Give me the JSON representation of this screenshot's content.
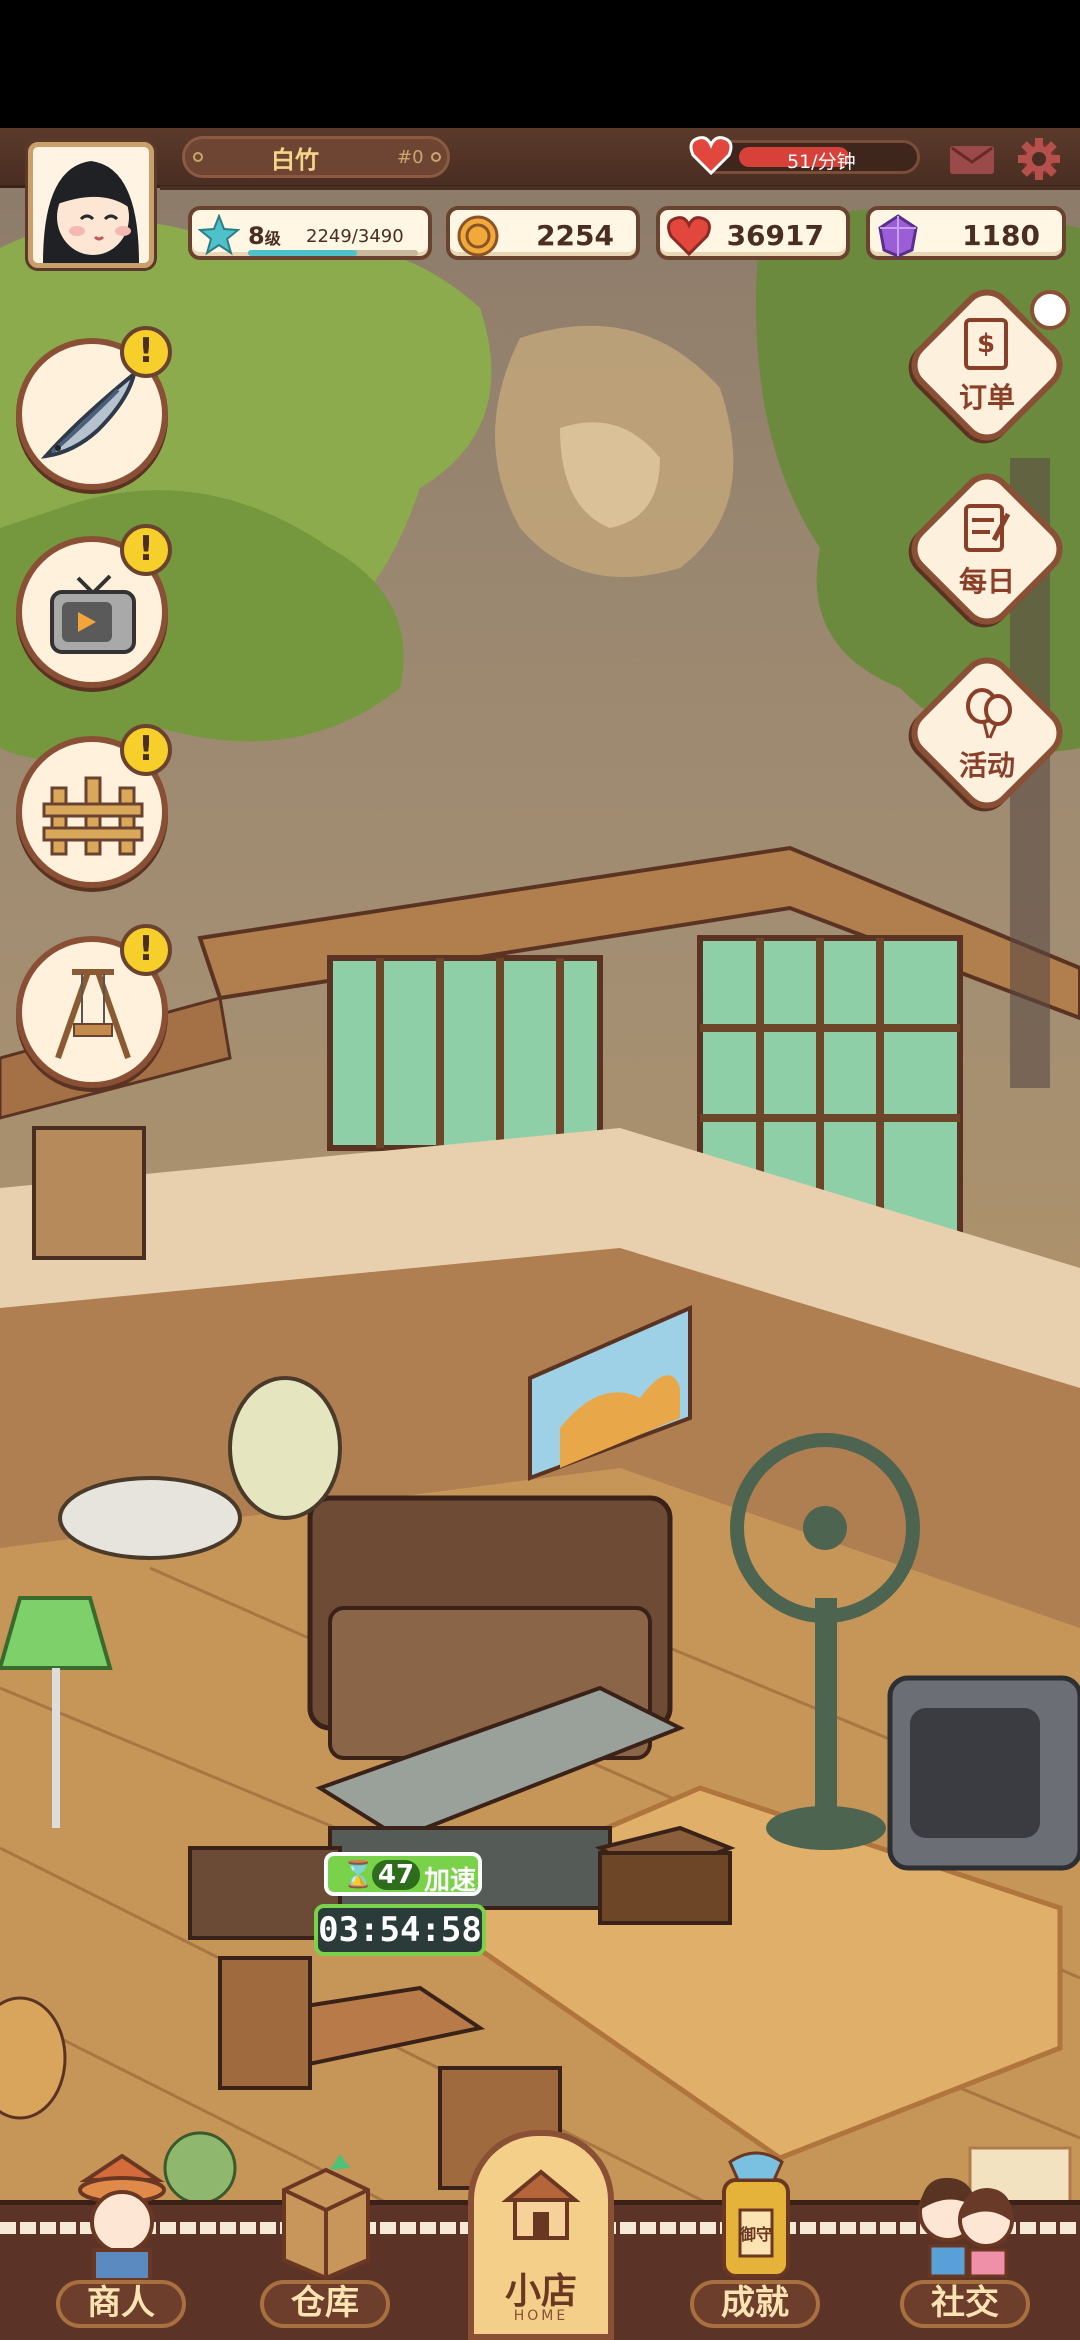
{
  "player": {
    "name": "白竹",
    "id": "#0",
    "energy_rate": "51/分钟",
    "level": "8",
    "level_unit": "级",
    "xp": "2249/3490",
    "xp_fraction": 0.644
  },
  "currencies": {
    "coins": "2254",
    "hearts": "36917",
    "gems": "1180"
  },
  "quests": [
    {
      "icon": "fish-icon",
      "alert": "!"
    },
    {
      "icon": "tv-video-icon",
      "alert": "!"
    },
    {
      "icon": "wooden-fence-icon",
      "alert": "!"
    },
    {
      "icon": "wooden-swing-icon",
      "alert": "!"
    }
  ],
  "right_buttons": {
    "orders": "订单",
    "daily": "每日",
    "events": "活动"
  },
  "timer": {
    "count": "47",
    "speedup": "加速",
    "time": "03:54:58"
  },
  "nav": {
    "merchant": "商人",
    "warehouse": "仓库",
    "shop": "小店",
    "shop_sub": "HOME",
    "achievements": "成就",
    "social": "社交",
    "charm_text": "御守"
  },
  "colors": {
    "hud_brown": "#5b3a2b",
    "alert_yellow": "#f7cf2a",
    "speed_green": "#7ad24a"
  }
}
